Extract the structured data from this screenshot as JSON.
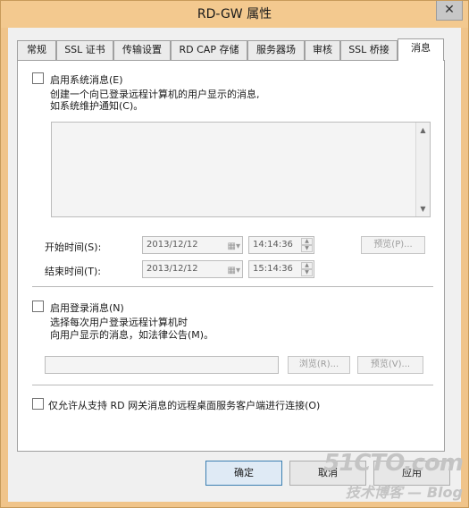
{
  "window": {
    "title": "RD-GW 属性",
    "close_glyph": "✕"
  },
  "tabs": [
    {
      "label": "常规",
      "active": false
    },
    {
      "label": "SSL 证书",
      "active": false
    },
    {
      "label": "传输设置",
      "active": false
    },
    {
      "label": "RD CAP 存储",
      "active": false
    },
    {
      "label": "服务器场",
      "active": false
    },
    {
      "label": "审核",
      "active": false
    },
    {
      "label": "SSL 桥接",
      "active": false
    },
    {
      "label": "消息",
      "active": true
    }
  ],
  "system_message": {
    "checkbox_label": "启用系统消息(E)",
    "checked": false,
    "description_line1": "创建一个向已登录远程计算机的用户显示的消息,",
    "description_line2": "如系统维护通知(C)。",
    "message_text": "",
    "start_label": "开始时间(S):",
    "start_date": "2013/12/12",
    "start_time": "14:14:36",
    "end_label": "结束时间(T):",
    "end_date": "2013/12/12",
    "end_time": "15:14:36",
    "preview_button": "预览(P)..."
  },
  "logon_message": {
    "checkbox_label": "启用登录消息(N)",
    "checked": false,
    "description_line1": "选择每次用户登录远程计算机时",
    "description_line2": "向用户显示的消息，如法律公告(M)。",
    "file_path": "",
    "browse_button": "浏览(R)...",
    "preview_button": "预览(V)..."
  },
  "only_allow": {
    "checkbox_label": "仅允许从支持 RD 网关消息的远程桌面服务客户端进行连接(O)",
    "checked": false
  },
  "footer": {
    "ok_button": "确定",
    "cancel_button": "取消",
    "apply_button": "应用"
  },
  "watermark": {
    "logo": "51CTO.com",
    "subtitle": "技术博客 — Blog"
  },
  "colors": {
    "titlebar": "#f3c98f",
    "primary_button_border": "#3c7fb1"
  }
}
